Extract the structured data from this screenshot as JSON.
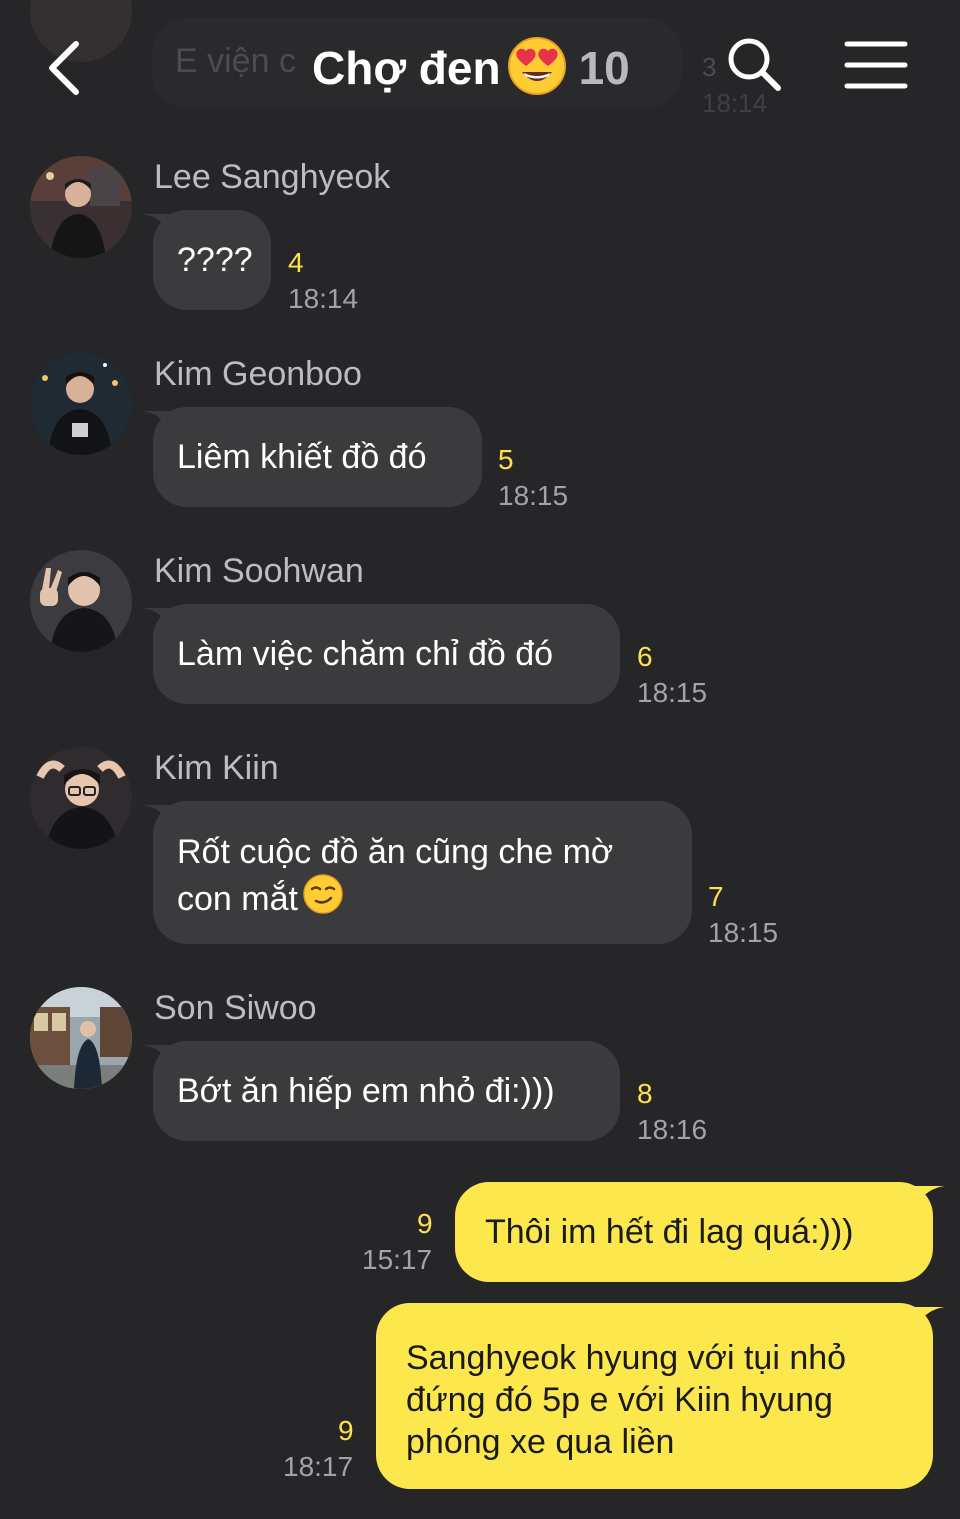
{
  "header": {
    "title": "Chợ đen",
    "title_emoji": "heart-eyes-emoji",
    "member_count": "10",
    "icons": [
      "back-icon",
      "search-icon",
      "menu-icon"
    ]
  },
  "previous_message": {
    "text": "E viện c",
    "count": "3",
    "time": "18:14"
  },
  "messages": [
    {
      "sender": "Lee Sanghyeok",
      "text": "????",
      "count": "4",
      "time": "18:14"
    },
    {
      "sender": "Kim Geonboo",
      "text": "Liêm khiết đồ đó",
      "count": "5",
      "time": "18:15"
    },
    {
      "sender": "Kim Soohwan",
      "text": "Làm việc chăm chỉ đồ đó",
      "count": "6",
      "time": "18:15"
    },
    {
      "sender": "Kim Kiin",
      "text_line1": "Rốt cuộc đồ ăn cũng che mờ",
      "text_line2": "con mắt",
      "emoji": "smirk-emoji",
      "count": "7",
      "time": "18:15"
    },
    {
      "sender": "Son Siwoo",
      "text": "Bớt ăn hiếp em nhỏ đi:)))",
      "count": "8",
      "time": "18:16"
    }
  ],
  "my_messages": [
    {
      "text": "Thôi im hết đi lag quá:)))",
      "count": "9",
      "time": "15:17"
    },
    {
      "text": "Sanghyeok hyung với tụi nhỏ đứng đó 5p e với Kiin hyung phóng xe qua liền",
      "count": "9",
      "time": "18:17"
    }
  ],
  "colors": {
    "background": "#262629",
    "incoming_bubble": "#3b3b3e",
    "outgoing_bubble": "#fce84d",
    "unread_count": "#ffe14d"
  }
}
